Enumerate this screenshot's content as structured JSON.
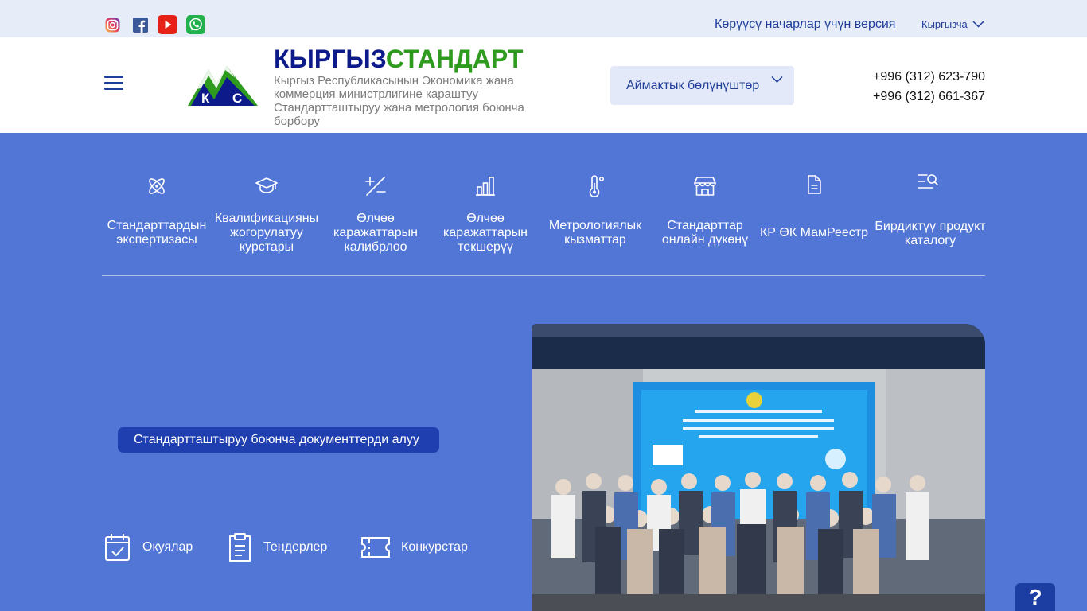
{
  "topbar": {
    "social": [
      "instagram-icon",
      "facebook-icon",
      "youtube-icon",
      "whatsapp-icon"
    ],
    "accessibility_label": "Көрүүсү начарлар үчүн версия",
    "language_label": "Кыргызча"
  },
  "header": {
    "brand_part1": "КЫРГЫЗ",
    "brand_part2": "СТАНДАРТ",
    "logo_letters": [
      "К",
      "С"
    ],
    "subtitle": "Кыргыз Республикасынын Экономика жана коммерция министрлигине караштуу Стандартташтыруу жана метрология боюнча борбору",
    "region_label": "Аймактык бөлүнүштөр",
    "phones": [
      "+996 (312) 623-790",
      "+996 (312) 661-367"
    ]
  },
  "services": [
    {
      "label": "Стандарттардын экспертизасы",
      "icon": "atom-icon"
    },
    {
      "label": "Квалификацияны жогорулатуу курстары",
      "icon": "graduation-cap-icon"
    },
    {
      "label": "Өлчөө каражаттарын калибрлөө",
      "icon": "plus-minus-icon"
    },
    {
      "label": "Өлчөө каражаттарын текшерүү",
      "icon": "bar-chart-icon"
    },
    {
      "label": "Метрологиялык кызматтар",
      "icon": "thermometer-icon"
    },
    {
      "label": "Стандарттар онлайн дүкөнү",
      "icon": "store-icon"
    },
    {
      "label": "КР ӨК МамРеестр",
      "icon": "document-icon"
    },
    {
      "label": "Бирдиктүү продукт каталогу",
      "icon": "list-search-icon"
    }
  ],
  "main": {
    "doc_button": "Стандартташтыруу боюнча документтерди алуу",
    "links": [
      {
        "label": "Окуялар",
        "icon": "calendar-check-icon"
      },
      {
        "label": "Тендерлер",
        "icon": "clipboard-icon"
      },
      {
        "label": "Конкурстар",
        "icon": "ticket-icon"
      }
    ]
  },
  "help_label": "?",
  "colors": {
    "brand_dark": "#0d1b8a",
    "brand_green": "#2e9b1f",
    "page_blue": "#5276d6",
    "button_blue": "#1f3fb0"
  }
}
